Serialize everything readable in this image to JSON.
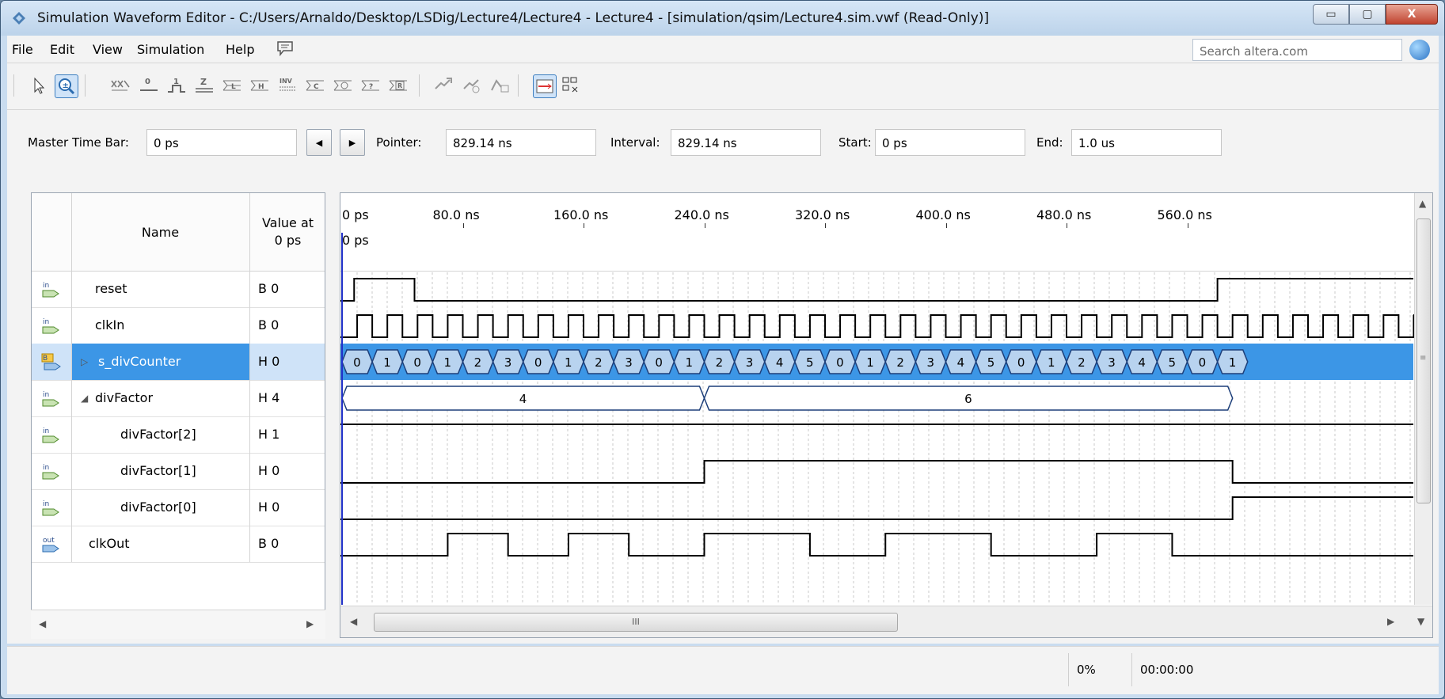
{
  "window": {
    "title": "Simulation Waveform Editor - C:/Users/Arnaldo/Desktop/LSDig/Lecture4/Lecture4 - Lecture4 - [simulation/qsim/Lecture4.sim.vwf (Read-Only)]",
    "minimize_glyph": "▭",
    "maximize_glyph": "▢",
    "close_glyph": "X"
  },
  "menu": {
    "items": [
      "File",
      "Edit",
      "View",
      "Simulation",
      "Help"
    ],
    "search_placeholder": "Search altera.com"
  },
  "timebar": {
    "master_label": "Master Time Bar:",
    "master_value": "0 ps",
    "pointer_label": "Pointer:",
    "pointer_value": "829.14 ns",
    "interval_label": "Interval:",
    "interval_value": "829.14 ns",
    "start_label": "Start:",
    "start_value": "0 ps",
    "end_label": "End:",
    "end_value": "1.0 us"
  },
  "table": {
    "name_header": "Name",
    "value_header_line1": "Value at",
    "value_header_line2": "0 ps",
    "signals": [
      {
        "name": "reset",
        "value": "B 0",
        "icon": "input-pin-icon",
        "icon_text": "in"
      },
      {
        "name": "clkIn",
        "value": "B 0",
        "icon": "input-pin-icon",
        "icon_text": "in"
      },
      {
        "name": "s_divCounter",
        "value": "H 0",
        "icon": "bus-icon",
        "icon_text": "B",
        "selected": true
      },
      {
        "name": "divFactor",
        "value": "H 4",
        "icon": "input-bus-icon",
        "icon_text": "in"
      },
      {
        "name": "divFactor[2]",
        "value": "H 1",
        "icon": "input-pin-icon",
        "icon_text": "in"
      },
      {
        "name": "divFactor[1]",
        "value": "H 0",
        "icon": "input-pin-icon",
        "icon_text": "in"
      },
      {
        "name": "divFactor[0]",
        "value": "H 0",
        "icon": "input-pin-icon",
        "icon_text": "in"
      },
      {
        "name": "clkOut",
        "value": "B 0",
        "icon": "output-pin-icon",
        "icon_text": "out"
      }
    ]
  },
  "ruler": {
    "ticks": [
      "0 ps",
      "80.0 ns",
      "160.0 ns",
      "240.0 ns",
      "320.0 ns",
      "400.0 ns",
      "480.0 ns",
      "560.0 ns"
    ],
    "cursor_label": "0 ps"
  },
  "waveforms": {
    "s_divCounter_values": [
      "0",
      "1",
      "0",
      "1",
      "2",
      "3",
      "0",
      "1",
      "2",
      "3",
      "0",
      "1",
      "2",
      "3",
      "4",
      "5",
      "0",
      "1",
      "2",
      "3",
      "4",
      "5",
      "0",
      "1",
      "2",
      "3",
      "4",
      "5",
      "0",
      "1"
    ],
    "divFactor_values": [
      "4",
      "6"
    ]
  },
  "status": {
    "progress": "0%",
    "elapsed": "00:00:00"
  },
  "colors": {
    "selection": "#3c96e6",
    "bus_fill": "#b8d3ef",
    "wave": "#000000",
    "cursor": "#2030c8"
  }
}
